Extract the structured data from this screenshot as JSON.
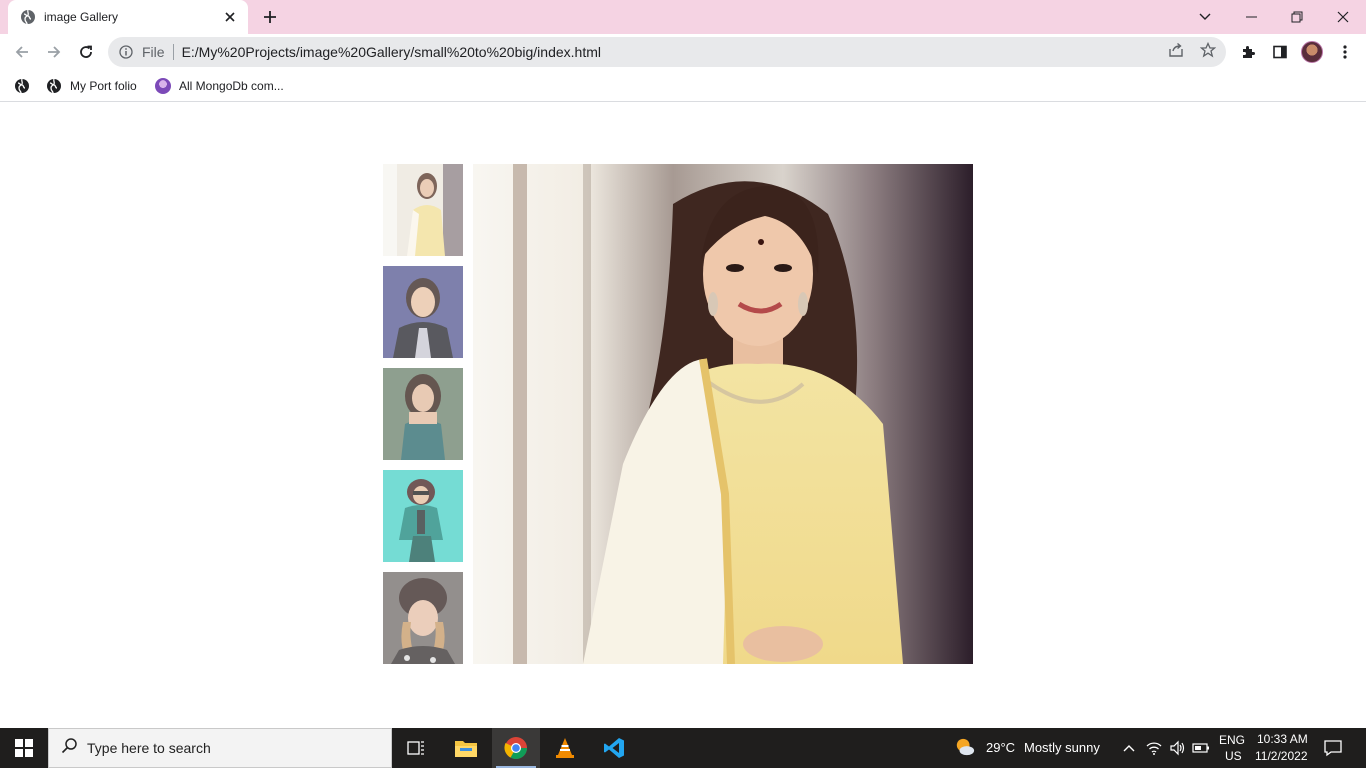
{
  "browser": {
    "tab": {
      "title": "image Gallery"
    },
    "address_bar": {
      "scheme_label": "File",
      "url": "E:/My%20Projects/image%20Gallery/small%20to%20big/index.html"
    },
    "bookmarks": [
      {
        "label": ""
      },
      {
        "label": "My Port folio"
      },
      {
        "label": "All MongoDb com..."
      }
    ]
  },
  "gallery": {
    "thumbnails": [
      {
        "name": "thumbnail-1",
        "palette": [
          "#e9e2d6",
          "#f2e6b8",
          "#6b4a3a"
        ]
      },
      {
        "name": "thumbnail-2",
        "palette": [
          "#6a6aa0",
          "#2c2c3a",
          "#e8c2a8"
        ]
      },
      {
        "name": "thumbnail-3",
        "palette": [
          "#5f7a66",
          "#2f6b6e",
          "#dcb59c"
        ]
      },
      {
        "name": "thumbnail-4",
        "palette": [
          "#4dd2c8",
          "#1e7f75",
          "#2a3b3a"
        ]
      },
      {
        "name": "thumbnail-5",
        "palette": [
          "#6e6563",
          "#3b2c2a",
          "#e4bfa8"
        ]
      }
    ],
    "main_image": {
      "palette": [
        "#f3efe6",
        "#f0db8e",
        "#4a2e25",
        "#7d6f72"
      ]
    }
  },
  "taskbar": {
    "search_placeholder": "Type here to search",
    "weather": {
      "temp": "29°C",
      "condition": "Mostly sunny"
    },
    "language": {
      "line1": "ENG",
      "line2": "US"
    },
    "clock": {
      "time": "10:33 AM",
      "date": "11/2/2022"
    }
  }
}
